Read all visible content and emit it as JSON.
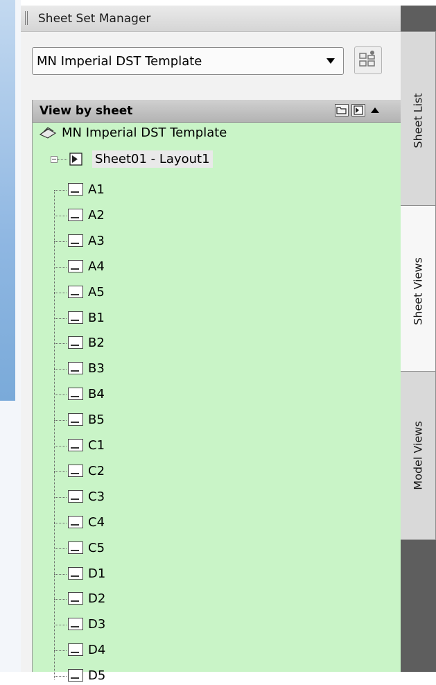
{
  "palette": {
    "title": "Sheet Set Manager"
  },
  "sheet_set_select": {
    "value": "MN Imperial DST Template"
  },
  "view_header": {
    "label": "View by sheet"
  },
  "tree": {
    "root_label": "MN Imperial DST Template",
    "sheet_label": "Sheet01 - Layout1",
    "views": [
      "A1",
      "A2",
      "A3",
      "A4",
      "A5",
      "B1",
      "B2",
      "B3",
      "B4",
      "B5",
      "C1",
      "C2",
      "C3",
      "C4",
      "C5",
      "D1",
      "D2",
      "D3",
      "D4",
      "D5"
    ]
  },
  "tabs": [
    {
      "label": "Sheet List",
      "active": false
    },
    {
      "label": "Sheet Views",
      "active": true
    },
    {
      "label": "Model Views",
      "active": false
    }
  ],
  "colors": {
    "tree_background": "#c9f4c7",
    "tab_strip": "#5e5e5e"
  }
}
